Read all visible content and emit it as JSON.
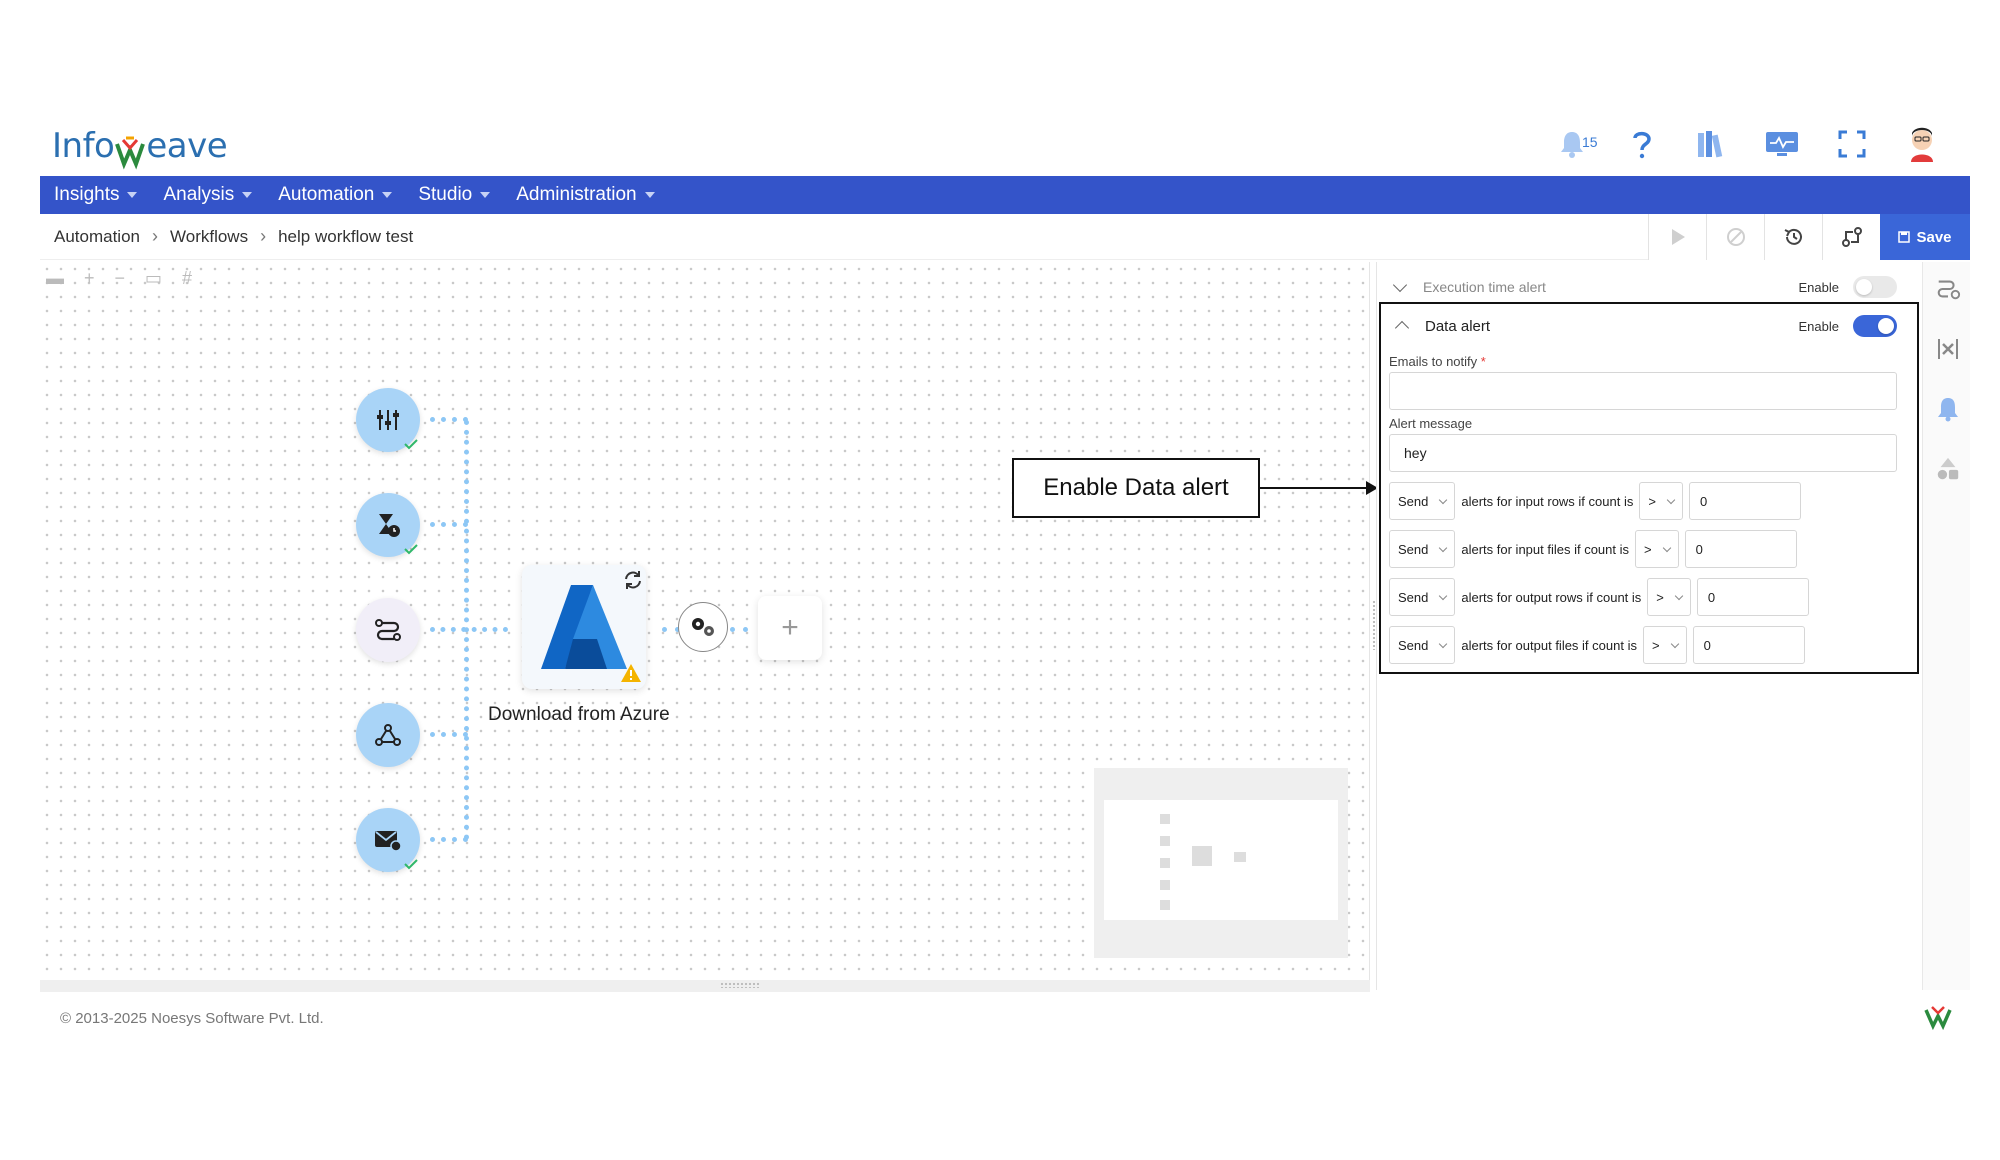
{
  "brand": {
    "logo_left": "Info",
    "logo_right": "eave"
  },
  "top_icons": {
    "notifications_count": "15"
  },
  "nav": {
    "items": [
      "Insights",
      "Analysis",
      "Automation",
      "Studio",
      "Administration"
    ]
  },
  "breadcrumb": {
    "items": [
      "Automation",
      "Workflows",
      "help workflow test"
    ]
  },
  "toolbar": {
    "save_label": "Save"
  },
  "canvas": {
    "node_label": "Download from Azure",
    "plus_label": "+"
  },
  "callout": {
    "text": "Enable Data alert"
  },
  "panel": {
    "exec_alert": {
      "title": "Execution time alert",
      "enable_label": "Enable",
      "enabled": false
    },
    "data_alert": {
      "title": "Data alert",
      "enable_label": "Enable",
      "enabled": true,
      "emails_label": "Emails to notify",
      "emails_required": "*",
      "emails_value": "",
      "message_label": "Alert message",
      "message_value": "hey",
      "rules": [
        {
          "action": "Send",
          "text": "alerts for input rows if count is",
          "operator": ">",
          "value": "0"
        },
        {
          "action": "Send",
          "text": "alerts for input files if count is",
          "operator": ">",
          "value": "0"
        },
        {
          "action": "Send",
          "text": "alerts for output rows if count is",
          "operator": ">",
          "value": "0"
        },
        {
          "action": "Send",
          "text": "alerts for output files if count is",
          "operator": ">",
          "value": "0"
        }
      ]
    }
  },
  "footer": {
    "copyright": "© 2013-2025 Noesys Software Pvt. Ltd."
  },
  "colors": {
    "nav": "#3454c9",
    "accent": "#3a66d8",
    "node": "#a9d4f7"
  }
}
